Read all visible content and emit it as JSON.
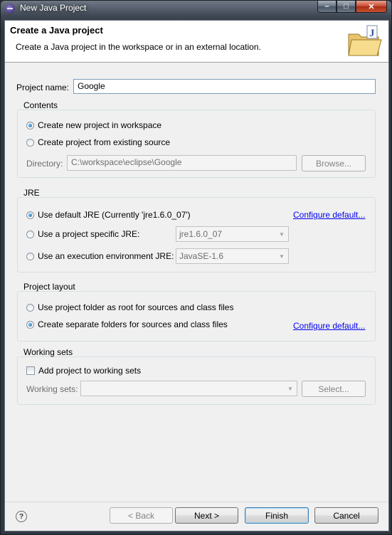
{
  "window": {
    "title": "New Java Project",
    "min_glyph": "–",
    "max_glyph": "□",
    "close_glyph": "✕"
  },
  "header": {
    "title": "Create a Java project",
    "description": "Create a Java project in the workspace or in an external location."
  },
  "project_name": {
    "label": "Project name:",
    "value": "Google"
  },
  "contents": {
    "title": "Contents",
    "option_new": "Create new project in workspace",
    "option_existing": "Create project from existing source",
    "directory_label": "Directory:",
    "directory_value": "C:\\workspace\\eclipse\\Google",
    "browse_label": "Browse..."
  },
  "jre": {
    "title": "JRE",
    "option_default": "Use default JRE (Currently 'jre1.6.0_07')",
    "configure_link": "Configure default...",
    "option_specific": "Use a project specific JRE:",
    "specific_value": "jre1.6.0_07",
    "option_env": "Use an execution environment JRE:",
    "env_value": "JavaSE-1.6"
  },
  "layout": {
    "title": "Project layout",
    "option_root": "Use project folder as root for sources and class files",
    "option_separate": "Create separate folders for sources and class files",
    "configure_link": "Configure default..."
  },
  "working_sets": {
    "title": "Working sets",
    "add_label": "Add project to working sets",
    "sets_label": "Working sets:",
    "select_label": "Select..."
  },
  "footer": {
    "help_glyph": "?",
    "back_label": "< Back",
    "next_label": "Next >",
    "finish_label": "Finish",
    "cancel_label": "Cancel"
  }
}
